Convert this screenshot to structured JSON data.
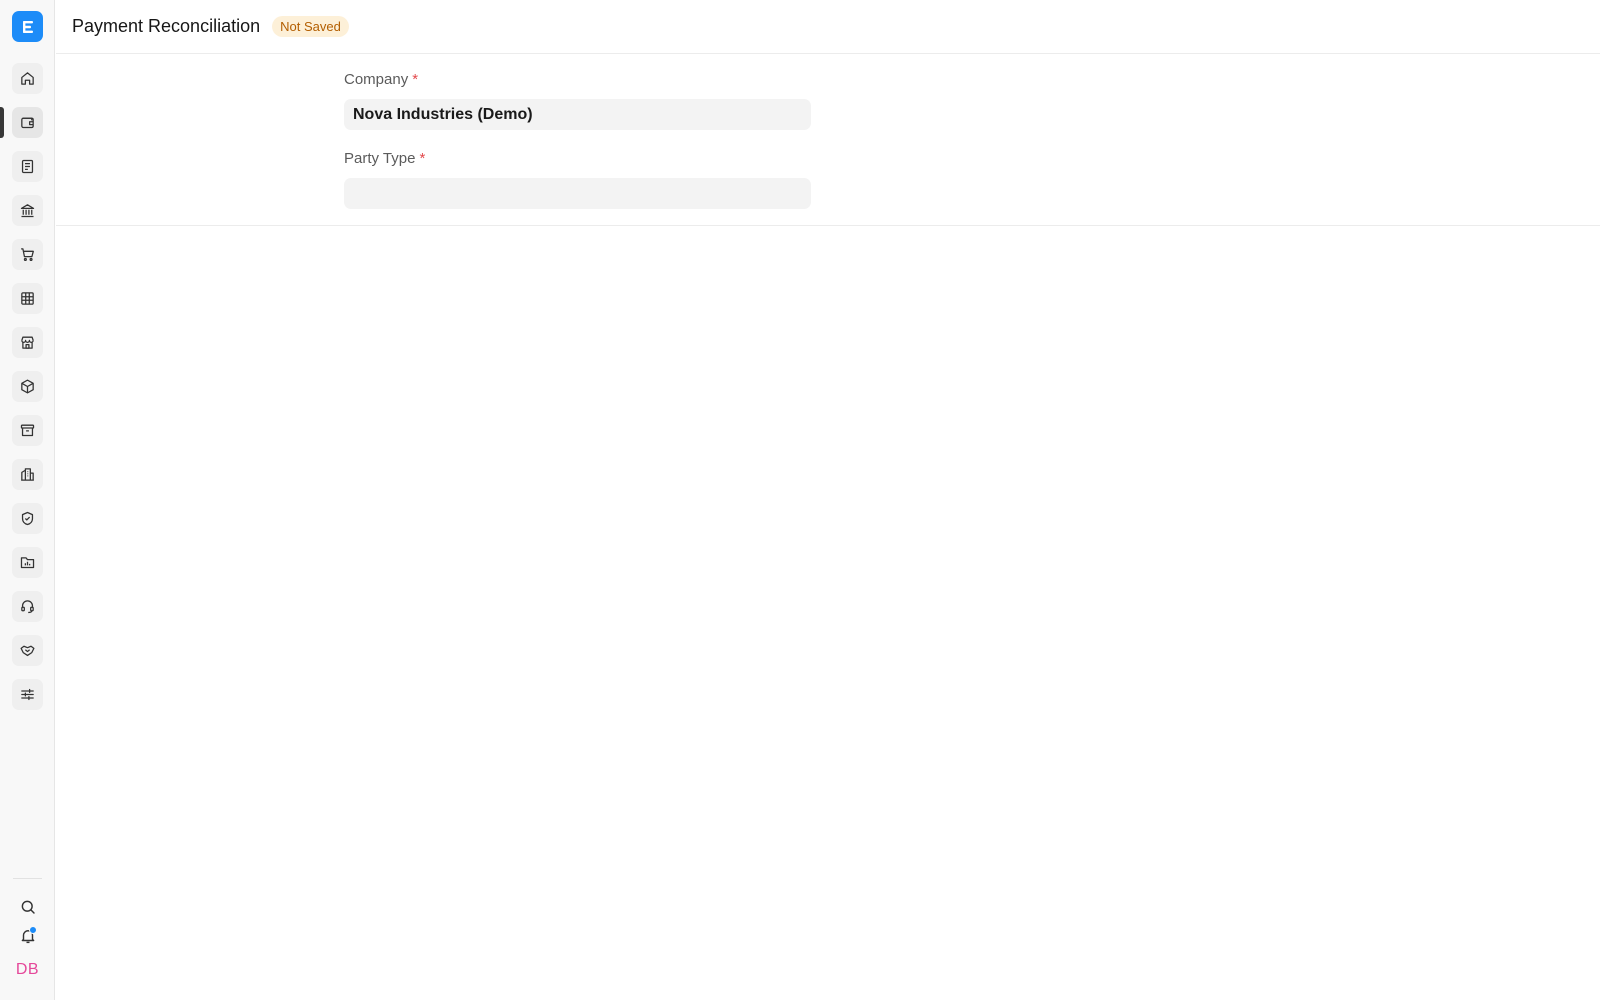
{
  "app": {
    "logo_icon": "erpnext-logo-icon",
    "accent": "#1d8cf8"
  },
  "sidebar": {
    "items": [
      {
        "icon": "home-icon"
      },
      {
        "icon": "wallet-icon",
        "active": true
      },
      {
        "icon": "invoice-icon"
      },
      {
        "icon": "bank-icon"
      },
      {
        "icon": "cart-icon"
      },
      {
        "icon": "table-icon"
      },
      {
        "icon": "store-icon"
      },
      {
        "icon": "package-icon"
      },
      {
        "icon": "archive-icon"
      },
      {
        "icon": "building-icon"
      },
      {
        "icon": "shield-check-icon"
      },
      {
        "icon": "folder-chart-icon"
      },
      {
        "icon": "headset-icon"
      },
      {
        "icon": "handshake-icon"
      },
      {
        "icon": "sliders-icon"
      }
    ],
    "bottom": {
      "search_icon": "search-icon",
      "notification_icon": "bell-icon",
      "avatar_initials": "DB"
    }
  },
  "header": {
    "title": "Payment Reconciliation",
    "status": "Not Saved"
  },
  "form": {
    "company": {
      "label": "Company",
      "required_mark": "*",
      "value": "Nova Industries (Demo)"
    },
    "party_type": {
      "label": "Party Type",
      "required_mark": "*",
      "value": ""
    }
  }
}
